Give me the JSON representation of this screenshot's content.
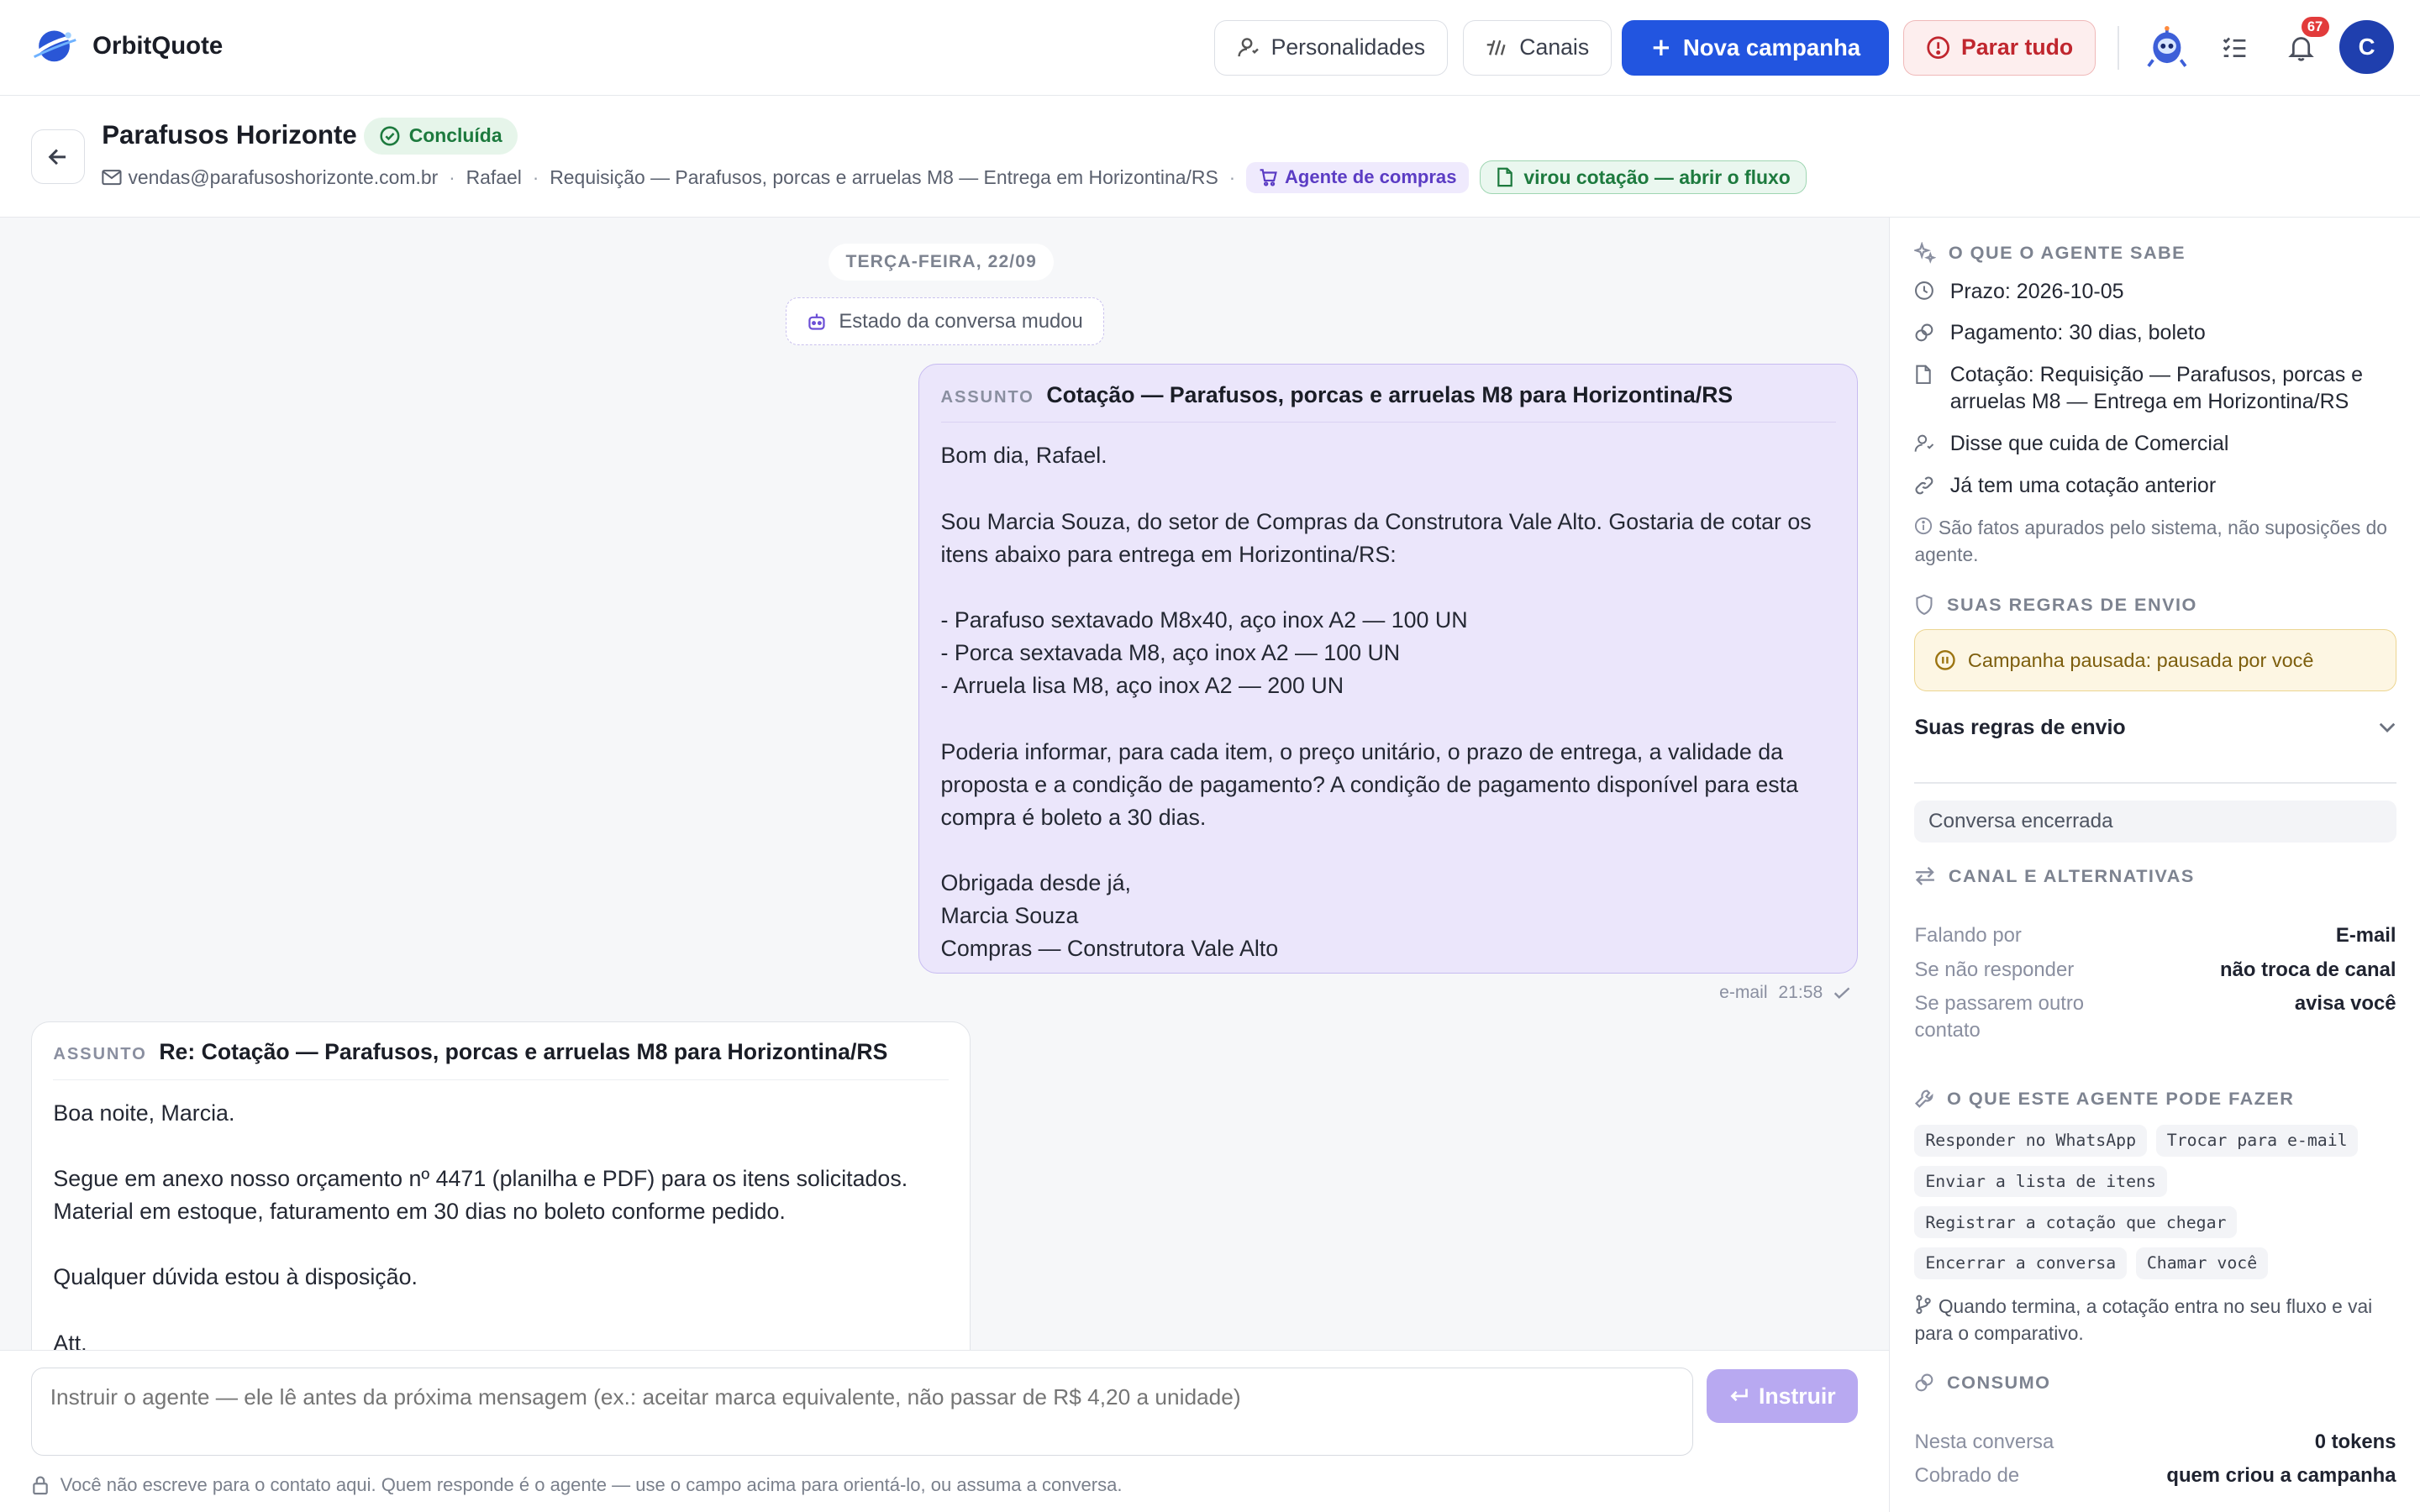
{
  "app": {
    "name": "OrbitQuote"
  },
  "topbar": {
    "personalities_label": "Personalidades",
    "channels_label": "Canais",
    "new_campaign_label": "Nova campanha",
    "stop_all_label": "Parar tudo",
    "notifications_count": "67",
    "avatar_initial": "C"
  },
  "header": {
    "contact_name": "Parafusos Horizonte",
    "status": "Concluída",
    "email": "vendas@parafusoshorizonte.com.br",
    "person": "Rafael",
    "requisition": "Requisição — Parafusos, porcas e arruelas M8 — Entrega em Horizontina/RS",
    "agent_badge": "Agente de compras",
    "flow_link": "virou cotação — abrir o fluxo"
  },
  "conversation": {
    "date_label": "TERÇA-FEIRA, 22/09",
    "state_changed": "Estado da conversa mudou",
    "subject_label": "ASSUNTO",
    "outgoing": {
      "subject": "Cotação — Parafusos, porcas e arruelas M8 para Horizontina/RS",
      "body": "Bom dia, Rafael.\n\nSou Marcia Souza, do setor de Compras da Construtora Vale Alto. Gostaria de cotar os itens abaixo para entrega em Horizontina/RS:\n\n- Parafuso sextavado M8x40, aço inox A2 — 100 UN\n- Porca sextavada M8, aço inox A2 — 100 UN\n- Arruela lisa M8, aço inox A2 — 200 UN\n\nPoderia informar, para cada item, o preço unitário, o prazo de entrega, a validade da proposta e a condição de pagamento? A condição de pagamento disponível para esta compra é boleto a 30 dias.\n\nObrigada desde já,\nMarcia Souza\nCompras — Construtora Vale Alto",
      "channel": "e-mail",
      "time": "21:58"
    },
    "incoming": {
      "subject": "Re: Cotação — Parafusos, porcas e arruelas M8 para Horizontina/RS",
      "body": "Boa noite, Marcia.\n\nSegue em anexo nosso orçamento nº 4471 (planilha e PDF) para os itens solicitados.\nMaterial em estoque, faturamento em 30 dias no boleto conforme pedido.\n\nQualquer dúvida estou à disposição.\n\nAtt,"
    }
  },
  "composer": {
    "placeholder": "Instruir o agente — ele lê antes da próxima mensagem (ex.: aceitar marca equivalente, não passar de R$ 4,20 a unidade)",
    "instruct_label": "Instruir",
    "hint": "Você não escreve para o contato aqui. Quem responde é o agente — use o campo acima para orientá-lo, ou assuma a conversa."
  },
  "panel": {
    "knows_title": "O QUE O AGENTE SABE",
    "facts": [
      "Prazo: 2026-10-05",
      "Pagamento: 30 dias, boleto",
      "Cotação: Requisição — Parafusos, porcas e arruelas M8 — Entrega em Horizontina/RS",
      "Disse que cuida de Comercial",
      "Já tem uma cotação anterior"
    ],
    "facts_note": "São fatos apurados pelo sistema, não suposições do agente.",
    "rules_title": "SUAS REGRAS DE ENVIO",
    "paused_text": "Campanha pausada: pausada por você",
    "rules_toggle": "Suas regras de envio",
    "closed_chip": "Conversa encerrada",
    "channel_title": "CANAL E ALTERNATIVAS",
    "channel_rows": [
      {
        "k": "Falando por",
        "v": "E-mail"
      },
      {
        "k": "Se não responder",
        "v": "não troca de canal"
      },
      {
        "k": "Se passarem outro contato",
        "v": "avisa você"
      }
    ],
    "can_do_title": "O QUE ESTE AGENTE PODE FAZER",
    "capabilities": [
      "Responder no WhatsApp",
      "Trocar para e-mail",
      "Enviar a lista de itens",
      "Registrar a cotação que chegar",
      "Encerrar a conversa",
      "Chamar você"
    ],
    "flow_note": "Quando termina, a cotação entra no seu fluxo e vai para o comparativo.",
    "consumption_title": "CONSUMO",
    "consumption_rows": [
      {
        "k": "Nesta conversa",
        "v": "0 tokens"
      },
      {
        "k": "Cobrado de",
        "v": "quem criou a campanha"
      }
    ]
  },
  "colors": {
    "primary": "#2255e0",
    "danger": "#c0262e",
    "success": "#1d7a3e",
    "agent_purple": "#5b3cc4",
    "outgoing_bubble": "#ebe6fb"
  }
}
